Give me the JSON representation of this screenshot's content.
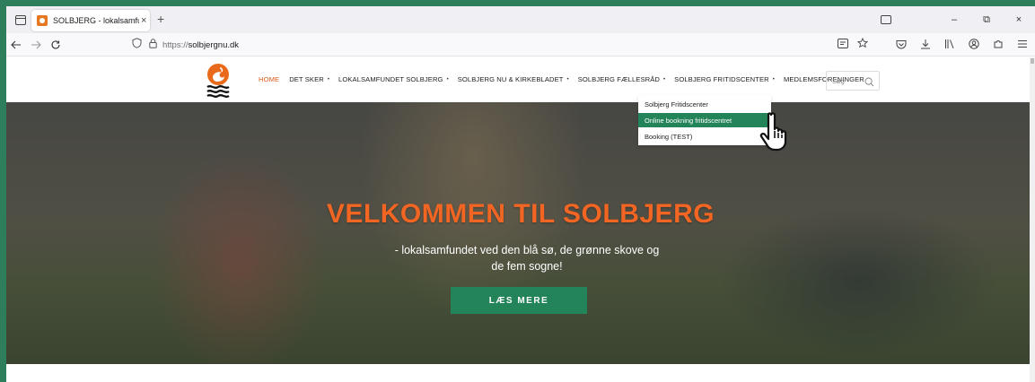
{
  "browser": {
    "tab_title": "SOLBJERG - lokalsamfundet ved",
    "tab_close": "×",
    "new_tab": "+",
    "url_scheme": "https://",
    "url_host": "solbjergnu.dk",
    "window_controls": {
      "minimize": "–",
      "restore": "⧉",
      "close": "×"
    }
  },
  "site": {
    "menu": [
      {
        "label": "HOME",
        "active": true,
        "has_caret": false
      },
      {
        "label": "DET SKER",
        "has_caret": true
      },
      {
        "label": "LOKALSAMFUNDET SOLBJERG",
        "has_caret": true
      },
      {
        "label": "SOLBJERG NU & KIRKEBLADET",
        "has_caret": true
      },
      {
        "label": "SOLBJERG FÆLLESRÅD",
        "has_caret": true
      },
      {
        "label": "SOLBJERG FRITIDSCENTER",
        "has_caret": true
      },
      {
        "label": "MEDLEMSFORENINGER",
        "has_caret": false
      }
    ],
    "caret": "•",
    "search_placeholder": "Søg",
    "dropdown": [
      {
        "label": "Solbjerg Fritidscenter"
      },
      {
        "label": "Online bookning fritidscentret",
        "highlight": true
      },
      {
        "label": "Booking (TEST)"
      }
    ],
    "hero": {
      "title": "VELKOMMEN TIL  SOLBJERG",
      "subtitle": "- lokalsamfundet ved den blå sø, de grønne skove og de fem sogne!",
      "button": "LÆS MERE"
    }
  },
  "colors": {
    "accent_orange": "#e05a1a",
    "hero_title": "#f26522",
    "brand_green": "#248459",
    "frame_green": "#2e7d5b"
  }
}
